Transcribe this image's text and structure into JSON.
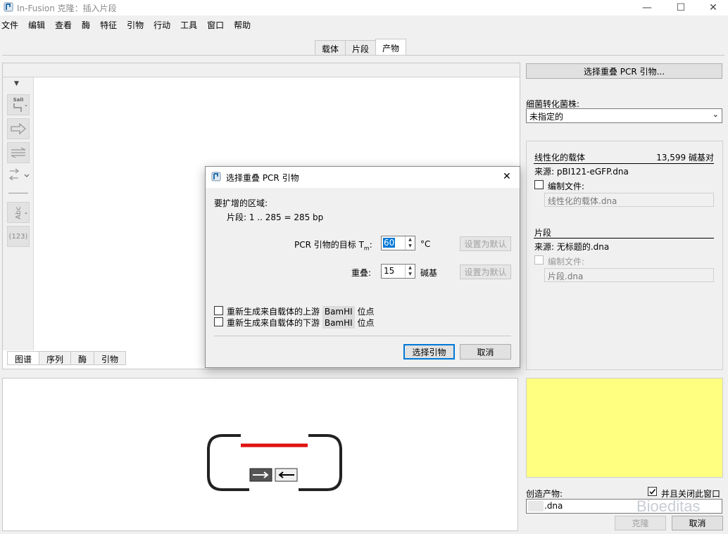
{
  "window": {
    "title": "In-Fusion 克隆：插入片段",
    "minimize": "—",
    "maximize": "☐",
    "close": "✕"
  },
  "menu": [
    "文件",
    "编辑",
    "查看",
    "酶",
    "特征",
    "引物",
    "行动",
    "工具",
    "窗口",
    "帮助"
  ],
  "top_tabs": [
    "载体",
    "片段",
    "产物"
  ],
  "active_top_tab": 2,
  "map_panel": {
    "toolbar": {
      "sall_label": "SalI",
      "abc_label": "Abc",
      "num_label": "(123)"
    },
    "bottom_tabs": [
      "图谱",
      "序列",
      "酶",
      "引物"
    ]
  },
  "right_panel": {
    "choose_primers_button": "选择重叠 PCR 引物...",
    "strain_label": "细菌转化菌株:",
    "strain_value": "未指定的",
    "vector": {
      "header": "线性化的载体",
      "size": "13,599 碱基对",
      "source": "来源:  pBI121-eGFP.dna",
      "edit_label": "编制文件:",
      "file_field": "线性化的载体.dna"
    },
    "fragment": {
      "header": "片段",
      "source": "来源:  无标题的.dna",
      "edit_label": "编制文件:",
      "file_field": "片段.dna"
    },
    "create_product_label": "创造产物:",
    "close_window_label": "并且关闭此窗口",
    "close_window_checked": true,
    "product_name": ".dna",
    "watermark": "Bioeditas",
    "clone_button": "克隆",
    "cancel_button": "取消"
  },
  "dialog": {
    "title": "选择重叠 PCR 引物",
    "close": "✕",
    "region_label": "要扩增的区域:",
    "fragment_line": "片段:  1 .. 285  =  285 bp",
    "tm_label": "PCR 引物的目标 T",
    "tm_sub": "m",
    "tm_colon": ":",
    "tm_value": "60",
    "tm_unit": "°C",
    "set_default_1": "设置为默认",
    "overlap_label": "重叠:",
    "overlap_value": "15",
    "overlap_unit": "碱基",
    "set_default_2": "设置为默认",
    "regen_upstream_pre": "重新生成来自载体的上游",
    "regen_downstream_pre": "重新生成来自载体的下游",
    "enzyme": "BamHI",
    "site_suffix": "位点",
    "select_button": "选择引物",
    "cancel_button": "取消"
  },
  "colors": {
    "accent": "#0078d7",
    "insert_red": "#e01010",
    "yellow_panel": "#ffff80"
  }
}
